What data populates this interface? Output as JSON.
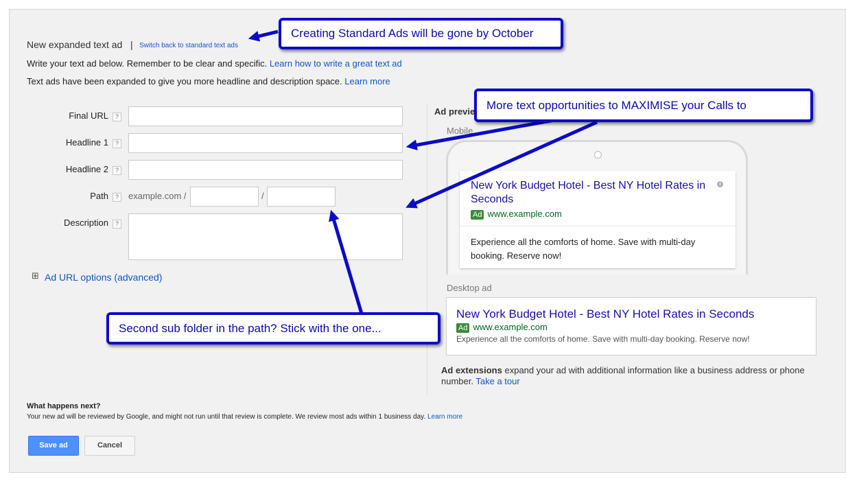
{
  "header": {
    "title": "New expanded text ad",
    "separator": "|",
    "switch_link": "Switch back to standard text ads"
  },
  "intro": {
    "line1_text": "Write your text ad below. Remember to be clear and specific.",
    "line1_link": "Learn how to write a great text ad",
    "line2_text": "Text ads have been expanded to give you more headline and description space.",
    "line2_link": "Learn more"
  },
  "form": {
    "help_glyph": "?",
    "final_url_label": "Final URL",
    "final_url_value": "",
    "headline1_label": "Headline 1",
    "headline1_value": "",
    "headline2_label": "Headline 2",
    "headline2_value": "",
    "path_label": "Path",
    "path_prefix": "example.com /",
    "path_separator": "/",
    "path1_value": "",
    "path2_value": "",
    "description_label": "Description",
    "description_value": "",
    "url_options_toggle": "⊞",
    "url_options_label": "Ad URL options (advanced)"
  },
  "preview": {
    "title_partial": "Ad previe",
    "mobile_label_partial": "Mobile",
    "mobile_ad": {
      "headline_line1": "New York Budget Hotel - Best NY Hotel Rates in",
      "headline_line2": "Seconds",
      "badge": "Ad",
      "url": "www.example.com",
      "description_line1": "Experience all the comforts of home. Save with multi-day",
      "description_line2": "booking. Reserve now!",
      "info_glyph": "i"
    },
    "desktop_label": "Desktop ad",
    "desktop_ad": {
      "headline": "New York Budget Hotel - Best NY Hotel Rates in Seconds",
      "badge": "Ad",
      "url": "www.example.com",
      "description": "Experience all the comforts of home. Save with multi-day booking. Reserve now!"
    },
    "extensions": {
      "bold": "Ad extensions",
      "text_line1": "expand your ad with additional information like a business address or phone",
      "text_line2": "number.",
      "link": "Take a tour"
    }
  },
  "footer": {
    "next_title": "What happens next?",
    "next_text": "Your new ad will be reviewed by Google, and might not run until that review is complete. We review most ads within 1 business day.",
    "next_link": "Learn more",
    "save_label": "Save ad",
    "cancel_label": "Cancel"
  },
  "annotations": {
    "callout1": "Creating Standard Ads will be gone by October",
    "callout2": "More text opportunities to MAXIMISE your Calls to",
    "callout3": "Second sub folder in the path? Stick with the one..."
  },
  "colors": {
    "link": "#1155cc",
    "ad_badge": "#3c8b3c",
    "url_green": "#006621",
    "primary_button": "#4d90fe",
    "annotation_blue": "#0b0bc9"
  }
}
